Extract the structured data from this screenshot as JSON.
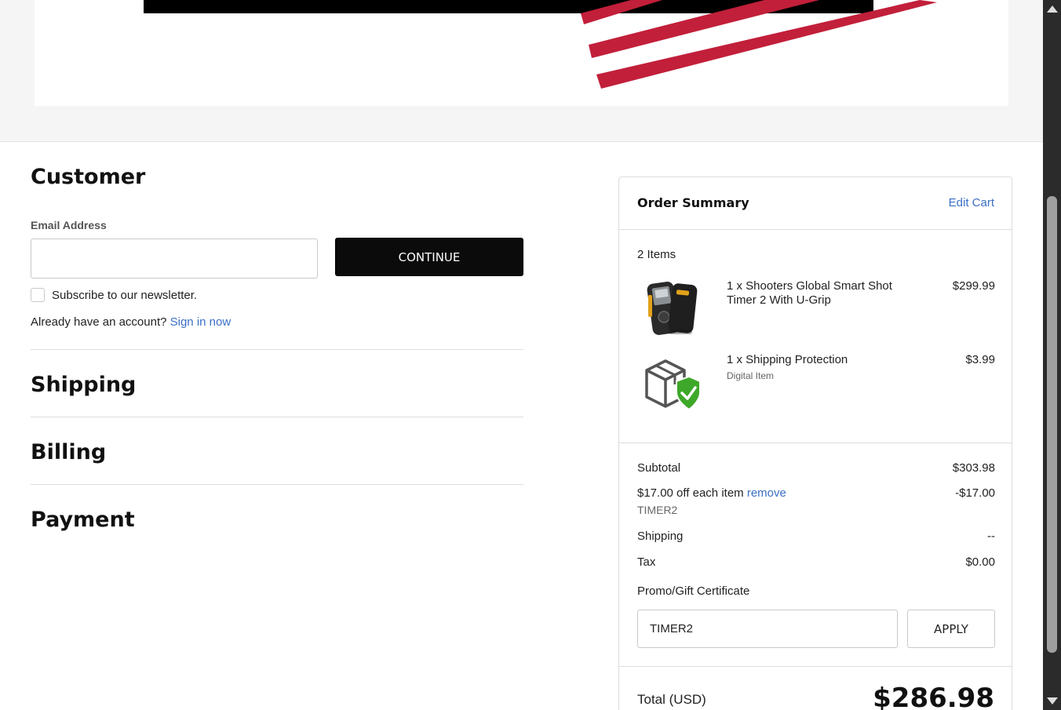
{
  "colors": {
    "accent_red": "#c21f3a",
    "link_blue": "#3a6fc4",
    "button_black": "#0b0b0b"
  },
  "customer": {
    "title": "Customer",
    "email_label": "Email Address",
    "email_value": "",
    "continue_label": "CONTINUE",
    "newsletter_label": "Subscribe to our newsletter.",
    "newsletter_checked": false,
    "account_prompt": "Already have an account?",
    "sign_in_label": "Sign in now"
  },
  "sections": {
    "shipping": "Shipping",
    "billing": "Billing",
    "payment": "Payment"
  },
  "order_summary": {
    "title": "Order Summary",
    "edit_cart_label": "Edit Cart",
    "items_count": "2 Items",
    "items": [
      {
        "name": "1 x Shooters Global Smart Shot Timer 2 With U-Grip",
        "sub": "",
        "price": "$299.99",
        "icon": "shot-timer-product-icon"
      },
      {
        "name": "1 x Shipping Protection",
        "sub": "Digital Item",
        "price": "$3.99",
        "icon": "shipping-protection-icon"
      }
    ],
    "subtotal_label": "Subtotal",
    "subtotal_value": "$303.98",
    "discount_label": "$17.00 off each item",
    "discount_remove_label": "remove",
    "discount_value": "-$17.00",
    "coupon_code": "TIMER2",
    "shipping_label": "Shipping",
    "shipping_value": "--",
    "tax_label": "Tax",
    "tax_value": "$0.00",
    "promo_label": "Promo/Gift Certificate",
    "promo_value": "TIMER2",
    "apply_label": "APPLY",
    "total_label": "Total (USD)",
    "total_value": "$286.98"
  }
}
